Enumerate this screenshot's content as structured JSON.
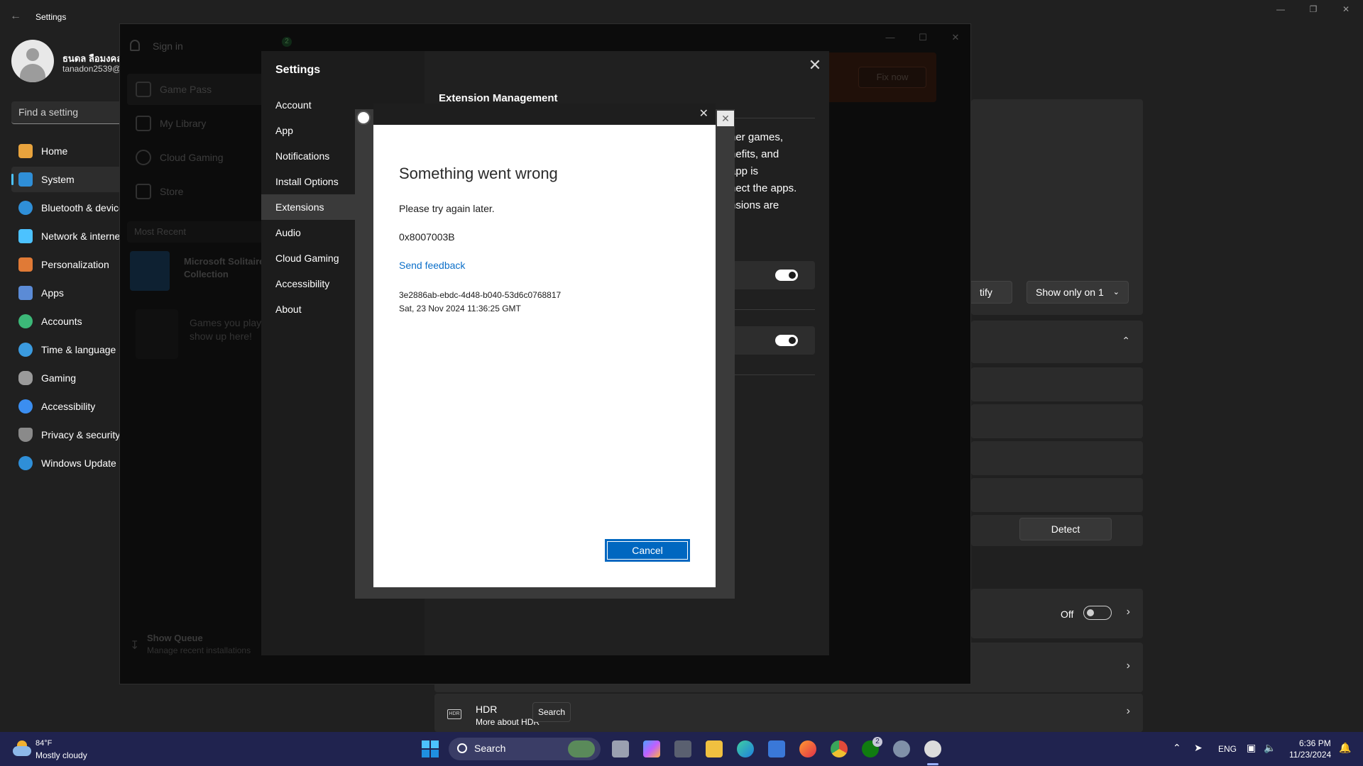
{
  "windows_settings": {
    "title": "Settings",
    "user_name": "ธนดล ลือมงคล",
    "user_email": "tanadon2539@",
    "search_placeholder": "Find a setting",
    "nav": [
      {
        "label": "Home",
        "icon": "home-icon",
        "color": "#e8a33d"
      },
      {
        "label": "System",
        "icon": "system-icon",
        "color": "#2f8fd8"
      },
      {
        "label": "Bluetooth & devices",
        "icon": "bluetooth-icon",
        "color": "#2f8fd8"
      },
      {
        "label": "Network & internet",
        "icon": "network-icon",
        "color": "#4cc2ff"
      },
      {
        "label": "Personalization",
        "icon": "brush-icon",
        "color": "#e07a36"
      },
      {
        "label": "Apps",
        "icon": "apps-icon",
        "color": "#5b8bd6"
      },
      {
        "label": "Accounts",
        "icon": "accounts-icon",
        "color": "#3cb878"
      },
      {
        "label": "Time & language",
        "icon": "globe-icon",
        "color": "#3b9be0"
      },
      {
        "label": "Gaming",
        "icon": "gamepad-icon",
        "color": "#9a9a9a"
      },
      {
        "label": "Accessibility",
        "icon": "accessibility-icon",
        "color": "#3b8ef0"
      },
      {
        "label": "Privacy & security",
        "icon": "shield-icon",
        "color": "#8a8a8a"
      },
      {
        "label": "Windows Update",
        "icon": "update-icon",
        "color": "#2f8fd8"
      }
    ],
    "content": {
      "identify_label": "tify",
      "show_only_label": "Show only on 1",
      "detect_label": "Detect",
      "off_label": "Off",
      "hdr_title": "HDR",
      "hdr_link": "More about HDR"
    }
  },
  "xbox_app": {
    "sign_in": "Sign in",
    "badge": "2",
    "fix_now": "Fix now",
    "sidebar": [
      {
        "label": "Game Pass"
      },
      {
        "label": "My Library"
      },
      {
        "label": "Cloud Gaming"
      },
      {
        "label": "Store"
      }
    ],
    "most_recent": "Most Recent",
    "recent_game": "Microsoft Solitaire Collection",
    "games_hint": "Games you play show up here!",
    "show_queue": "Show Queue",
    "show_queue_sub": "Manage recent installations"
  },
  "xbox_settings": {
    "title": "Settings",
    "nav": [
      "Account",
      "App",
      "Notifications",
      "Install Options",
      "Extensions",
      "Audio",
      "Cloud Gaming",
      "Accessibility",
      "About"
    ],
    "active_index": 4,
    "section_title": "Extension Management",
    "body_fragments": [
      "her games,",
      "nefits, and",
      "app is",
      "nect the apps.",
      "nsions are"
    ]
  },
  "dialog": {
    "heading": "Something went wrong",
    "message": "Please try again later.",
    "error_code": "0x8007003B",
    "feedback_link": "Send feedback",
    "correlation_id": "3e2886ab-ebdc-4d48-b040-53d6c0768817",
    "timestamp": "Sat, 23 Nov 2024 11:36:25 GMT",
    "cancel_label": "Cancel"
  },
  "taskbar": {
    "temp": "84°F",
    "condition": "Mostly cloudy",
    "search_label": "Search",
    "tooltip": "Search",
    "lang": "ENG",
    "time": "6:36 PM",
    "date": "11/23/2024",
    "xbox_badge": "2"
  }
}
